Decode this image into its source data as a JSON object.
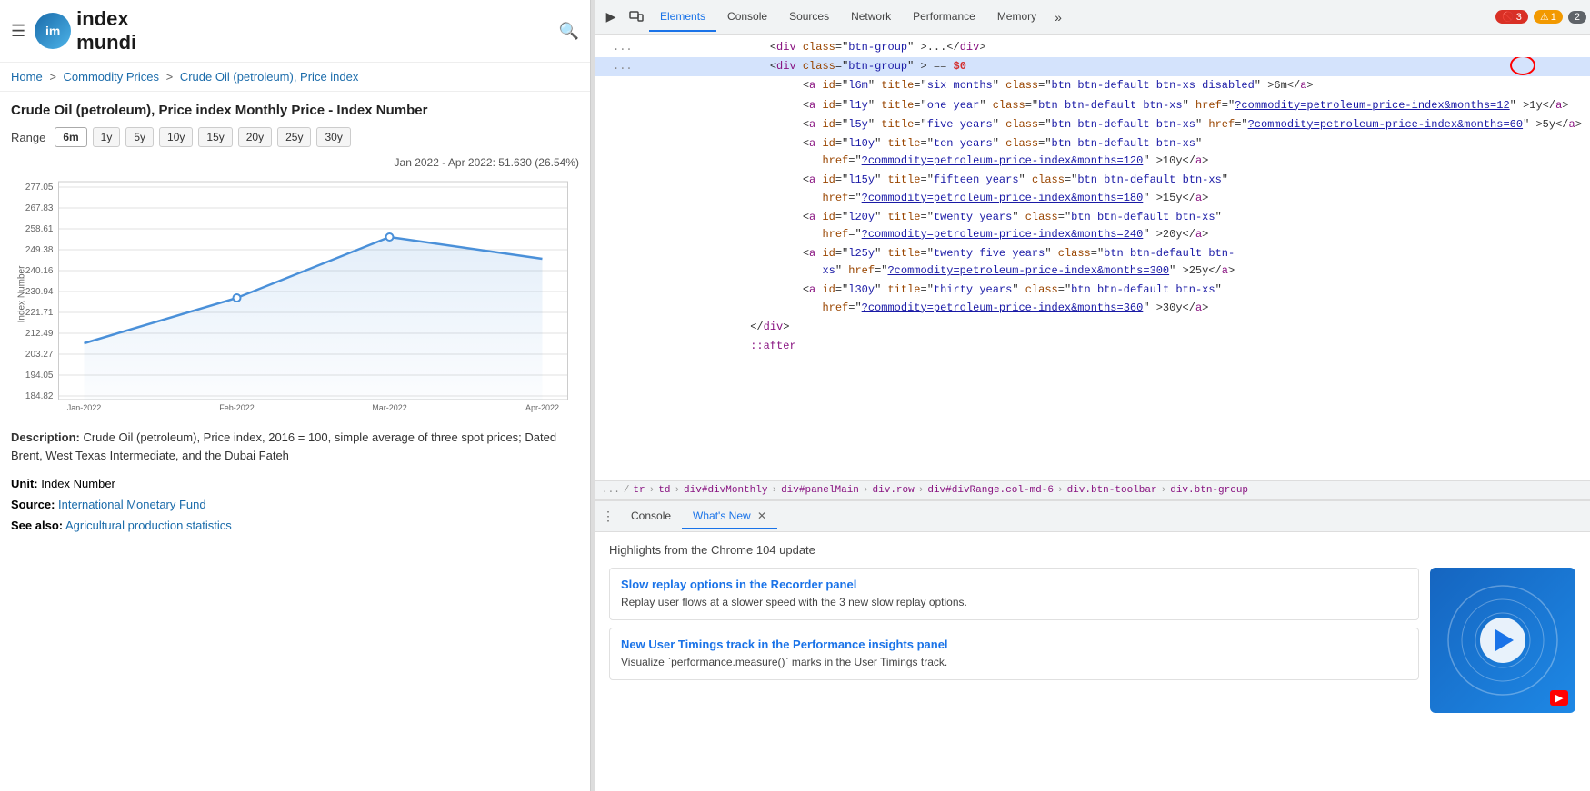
{
  "site": {
    "logo_text": "index\nmundi",
    "search_label": "🔍"
  },
  "breadcrumb": {
    "home": "Home",
    "separator1": " > ",
    "commodity_prices": "Commodity Prices",
    "separator2": " > ",
    "current": "Crude Oil (petroleum), Price index"
  },
  "page": {
    "title": "Crude Oil (petroleum), Price index Monthly Price - Index Number",
    "range_label": "Range",
    "range_options": [
      "6m",
      "1y",
      "5y",
      "10y",
      "15y",
      "20y",
      "25y",
      "30y"
    ],
    "active_range": "6m",
    "chart_info": "Jan 2022 - Apr 2022: 51.630 (26.54%)",
    "description_label": "Description:",
    "description_text": "Crude Oil (petroleum), Price index, 2016 = 100, simple average of three spot prices; Dated Brent, West Texas Intermediate, and the Dubai Fateh",
    "unit_label": "Unit:",
    "unit_value": "Index Number",
    "source_label": "Source:",
    "source_value": "International Monetary Fund",
    "seealso_label": "See also:",
    "seealso_value": "Agricultural production statistics"
  },
  "chart": {
    "y_labels": [
      "277.05",
      "267.83",
      "258.61",
      "249.38",
      "240.16",
      "230.94",
      "221.71",
      "212.49",
      "203.27",
      "194.05",
      "184.82"
    ],
    "x_labels": [
      "Jan-2022",
      "Feb-2022",
      "Mar-2022",
      "Apr-2022"
    ],
    "points": [
      {
        "x": 0.05,
        "y": 0.72
      },
      {
        "x": 0.35,
        "y": 0.47
      },
      {
        "x": 0.65,
        "y": 0.12
      },
      {
        "x": 0.95,
        "y": 0.22
      }
    ]
  },
  "devtools": {
    "tabs": [
      "Elements",
      "Console",
      "Sources",
      "Network",
      "Performance",
      "Memory",
      "»"
    ],
    "active_tab": "Elements",
    "badges": {
      "error": "3",
      "warn": "1",
      "other": "2"
    },
    "code": [
      {
        "indent": 20,
        "content": "<div class=\"btn-group\">...</div>",
        "selected": false,
        "type": "collapsed"
      },
      {
        "indent": 20,
        "content": "<div class=\"btn-group\"> == $0",
        "selected": true,
        "type": "open",
        "highlight": true
      },
      {
        "indent": 28,
        "content": "<a id=\"l6m\" title=\"six months\" class=\"btn btn-default btn-xs disabled\">6m</a>",
        "selected": false
      },
      {
        "indent": 28,
        "content": "<a id=\"l1y\" title=\"one year\" class=\"btn btn-default btn-xs\" href=\"",
        "selected": false,
        "link": "?commodity=petroleum-price-index&months=12",
        "end": "\">1y</a>"
      },
      {
        "indent": 28,
        "content": "<a id=\"l5y\" title=\"five years\" class=\"btn btn-default btn-xs\"",
        "selected": false,
        "link2": "?commodity=petroleum-price-index&months=60",
        "end2": ">5y</a>"
      },
      {
        "indent": 28,
        "content": "<a id=\"l10y\" title=\"ten years\" class=\"btn btn-default btn-xs\"",
        "selected": false,
        "link3": "?commodity=petroleum-price-index&months=120",
        "end3": ">10y</a>"
      },
      {
        "indent": 28,
        "content": "<a id=\"l15y\" title=\"fifteen years\" class=\"btn btn-default btn-xs\"",
        "selected": false,
        "link4": "?commodity=petroleum-price-index&months=180",
        "end4": ">15y</a>"
      },
      {
        "indent": 28,
        "content": "<a id=\"l20y\" title=\"twenty years\" class=\"btn btn-default btn-xs\"",
        "selected": false,
        "link5": "?commodity=petroleum-price-index&months=240",
        "end5": ">20y</a>"
      },
      {
        "indent": 28,
        "content": "<a id=\"l25y\" title=\"twenty five years\" class=\"btn btn-default btn-",
        "selected": false,
        "link6": "?commodity=petroleum-price-index&months=300",
        "end6": ">25y</a>"
      },
      {
        "indent": 28,
        "content": "<a id=\"l30y\" title=\"thirty years\" class=\"btn btn-default btn-xs\"",
        "selected": false,
        "link7": "?commodity=petroleum-price-index&months=360",
        "end7": ">30y</a>"
      },
      {
        "indent": 20,
        "content": "</div>",
        "selected": false,
        "type": "close"
      },
      {
        "indent": 20,
        "content": "::after",
        "selected": false,
        "type": "pseudo"
      }
    ],
    "breadcrumb_items": [
      "...",
      "/",
      "tr",
      "td",
      "div#divMonthly",
      "div#panelMain",
      "div.row",
      "div#divRange.col-md-6",
      "div.btn-toolbar",
      "div.btn-group"
    ],
    "bottom_tabs": [
      "Console",
      "What's New"
    ],
    "active_bottom_tab": "What's New",
    "whatsnew_header": "Highlights from the Chrome 104 update",
    "cards": [
      {
        "title": "Slow replay options in the Recorder panel",
        "description": "Replay user flows at a slower speed with the 3 new slow replay options."
      },
      {
        "title": "New User Timings track in the Performance insights panel",
        "description": "Visualize `performance.measure()` marks in the User Timings track."
      }
    ]
  }
}
